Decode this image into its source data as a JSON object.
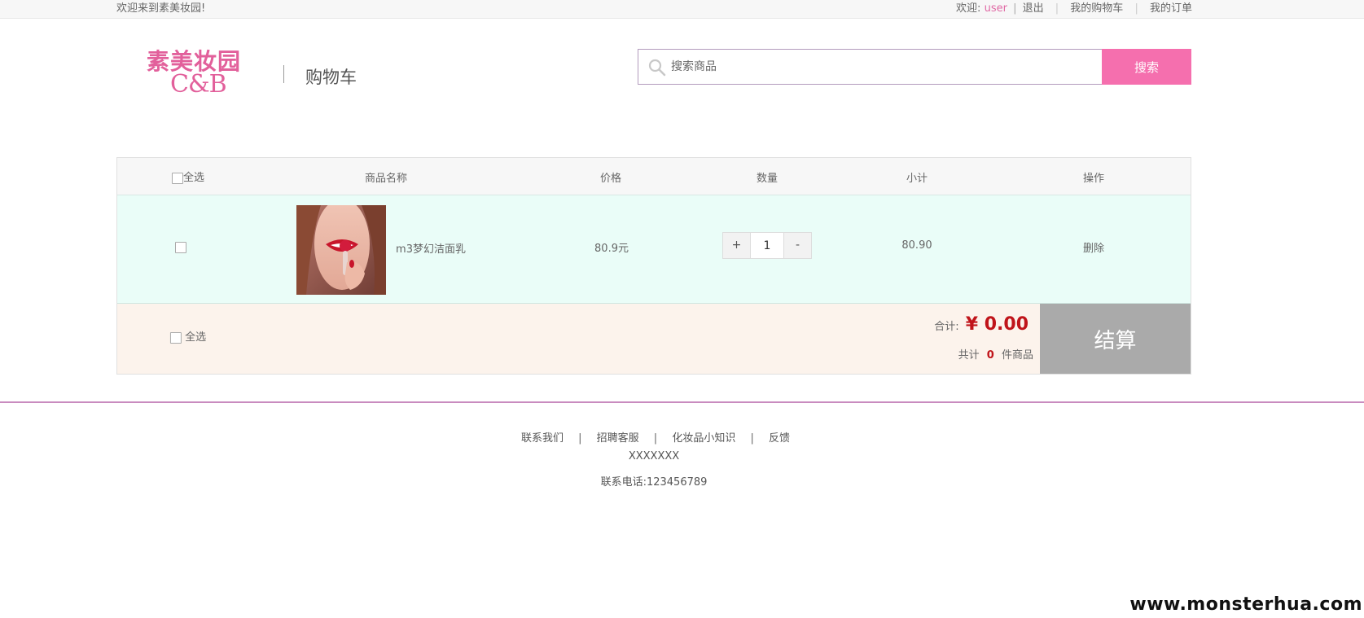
{
  "topbar": {
    "welcome": "欢迎来到素美妆园!",
    "greeting": "欢迎:",
    "username": "user",
    "logout": "退出",
    "my_cart": "我的购物车",
    "my_orders": "我的订单"
  },
  "header": {
    "logo_cn": "素美妆园",
    "logo_en": "C&B",
    "page_title": "购物车"
  },
  "search": {
    "placeholder": "搜索商品",
    "button": "搜索"
  },
  "cart": {
    "columns": {
      "select_all": "全选",
      "name": "商品名称",
      "price": "价格",
      "quantity": "数量",
      "subtotal": "小计",
      "action": "操作"
    },
    "items": [
      {
        "name": "m3梦幻洁面乳",
        "price": "80.9元",
        "quantity": "1",
        "subtotal": "80.90",
        "action": "删除"
      }
    ],
    "qty_plus": "+",
    "qty_minus": "-",
    "footer": {
      "select_all": "全选",
      "total_label": "合计:",
      "total_value": "¥ 0.00",
      "count_prefix": "共计",
      "count_value": "0",
      "count_suffix": "件商品",
      "checkout": "结算"
    }
  },
  "footer": {
    "links": [
      "联系我们",
      "招聘客服",
      "化妆品小知识",
      "反馈"
    ],
    "company": "XXXXXXX",
    "phone": "联系电话:123456789"
  },
  "watermark": "www.monsterhua.com",
  "colors": {
    "accent_pink": "#f56fae",
    "price_red": "#c0141a",
    "row_bg": "#eafdf8",
    "footer_bg": "#fcf3ec"
  }
}
